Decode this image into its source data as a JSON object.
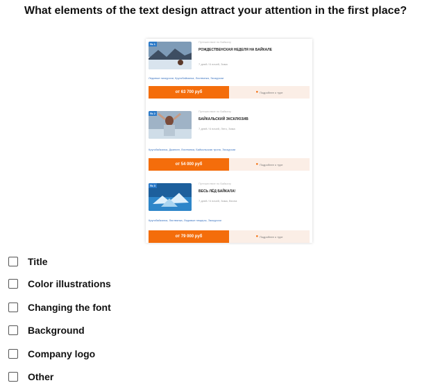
{
  "question": "What elements of the text design attract your attention in the first place?",
  "cards": [
    {
      "badge": "№ 1",
      "category": "Путешествие по Байкалу",
      "title": "РОЖДЕСТВЕНСКАЯ НЕДЕЛЯ НА БАЙКАЛЕ",
      "meta": "7 дней / 6 ночей, Зима",
      "tags": "Ледовые экскурсии, Кругобайкалка, Листвянка, Экскурсии",
      "price": "от 63 700 руб",
      "detail": "Подробнее о туре"
    },
    {
      "badge": "№ 2",
      "category": "Путешествие по Байкалу",
      "title": "БАЙКАЛЬСКИЙ ЭКСКЛЮЗИВ",
      "meta": "7 дней / 6 ночей, Лето, Зима",
      "tags": "Кругобайкалка, Джипинг, Листвянка, Байкальская тропа, Экскурсии",
      "price": "от 54 000 руб",
      "detail": "Подробнее о туре"
    },
    {
      "badge": "№ 3",
      "category": "Путешествие по Байкалу",
      "title": "ВЕСЬ ЛЁД БАЙКАЛА!",
      "meta": "7 дней / 6 ночей, Зима, Весна",
      "tags": "Кругобайкалка, Листвянка, Ледовые пещеры, Экскурсии",
      "price": "от 79 000 руб",
      "detail": "Подробнее о туре"
    }
  ],
  "options": [
    "Title",
    "Color illustrations",
    "Changing the font",
    "Background",
    "Company logo",
    "Other"
  ],
  "colors": {
    "accent": "#f46d0b",
    "detail_bg": "#fbeee6",
    "tag_blue": "#3b73c0"
  }
}
